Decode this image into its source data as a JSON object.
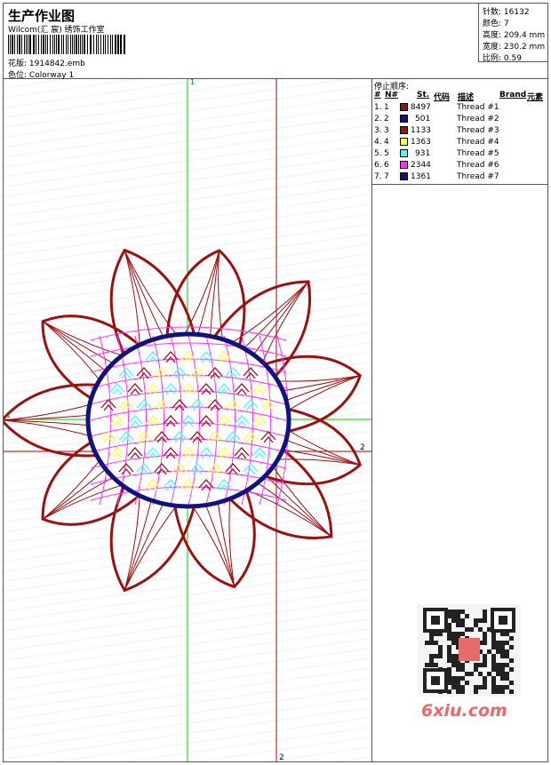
{
  "header": {
    "title": "生产作业图",
    "company": "Wilcom(汇 宸) 绣饰工作室",
    "file_label": "花版:",
    "file_name": "1914842.emb",
    "colorway_label": "色位:",
    "colorway": "Colorway 1"
  },
  "stats": {
    "stitches_label": "针数:",
    "stitches": "16132",
    "colors_label": "颜色:",
    "colors": "7",
    "height_label": "高度:",
    "height": "209.4 mm",
    "width_label": "宽度:",
    "width": "230.2 mm",
    "scale_label": "比例:",
    "scale": "0.59"
  },
  "stop_sequence": {
    "heading": "停止顺序:",
    "columns": {
      "hash": "#",
      "n": "N#",
      "st": "St.",
      "code": "代码",
      "desc": "描述",
      "brand": "Brand",
      "element": "元素"
    },
    "rows": [
      {
        "num": "1.",
        "n": "1",
        "color": "#9b1010",
        "stitches": "8497",
        "desc": "Thread #1"
      },
      {
        "num": "2.",
        "n": "2",
        "color": "#10127e",
        "stitches": "501",
        "desc": "Thread #2"
      },
      {
        "num": "3.",
        "n": "3",
        "color": "#9b1010",
        "stitches": "1133",
        "desc": "Thread #3"
      },
      {
        "num": "4.",
        "n": "4",
        "color": "#ffff40",
        "stitches": "1363",
        "desc": "Thread #4"
      },
      {
        "num": "5.",
        "n": "5",
        "color": "#40ffff",
        "stitches": "931",
        "desc": "Thread #5"
      },
      {
        "num": "6.",
        "n": "6",
        "color": "#ff30ff",
        "stitches": "2344",
        "desc": "Thread #6"
      },
      {
        "num": "7.",
        "n": "7",
        "color": "#10127e",
        "stitches": "1361",
        "desc": "Thread #7"
      }
    ]
  },
  "guides": {
    "green_top": "1",
    "green_left": "1",
    "red_right": "2",
    "red_bottom": "2"
  },
  "watermark": "6xiu.com",
  "colors": {
    "outline": "#9b1010",
    "ring": "#10127e",
    "net": "#ff30ff",
    "fill_yellow": "#ffff40",
    "fill_cyan": "#40ffff",
    "guide_green": "#00cc00",
    "guide_red": "#b00000"
  }
}
